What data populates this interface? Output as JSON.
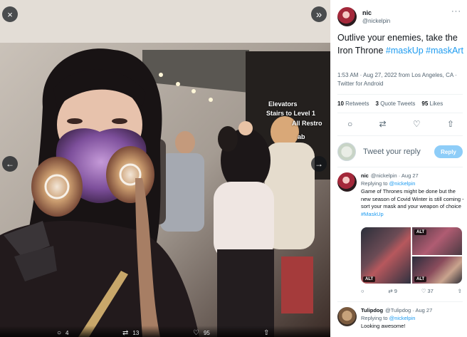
{
  "viewer": {
    "close_label": "×",
    "expand_label": "»",
    "prev_label": "←",
    "next_label": "→",
    "signage": {
      "elevators": "Elevators",
      "stairs": "Stairs to Level 1",
      "restrooms": "All Restro",
      "lab": "ab"
    },
    "bottom_bar": {
      "replies": "4",
      "retweets": "13",
      "likes": "95"
    }
  },
  "tweet": {
    "author": {
      "display_name": "nic",
      "handle": "@nickelpin"
    },
    "text_plain": "Outlive your enemies, take the Iron Throne ",
    "hashtag_1": "#maskUp",
    "hashtag_2": "#maskArt",
    "meta": "1:53 AM · Aug 27, 2022 from Los Angeles, CA · Twitter for Android",
    "stats": {
      "retweets_count": "10",
      "retweets_label": "Retweets",
      "quotes_count": "3",
      "quotes_label": "Quote Tweets",
      "likes_count": "95",
      "likes_label": "Likes"
    }
  },
  "reply_composer": {
    "placeholder": "Tweet your reply",
    "button_label": "Reply"
  },
  "replies": [
    {
      "display_name": "nic",
      "handle": "@nickelpin",
      "date": "· Aug 27",
      "replying_to_prefix": "Replying to",
      "replying_to_handle": "@nickelpin",
      "text": "Game of Thrones might be done but the new season of Covid Winter is still coming - sort your mask and your weapon of choice ",
      "hashtag": "#MaskUp",
      "media_alt_label": "ALT",
      "reply_count": "",
      "retweet_count": "9",
      "like_count": "37"
    },
    {
      "display_name": "Tulipdog",
      "handle": "@Tulipdog",
      "date": "· Aug 27",
      "replying_to_prefix": "Replying to",
      "replying_to_handle": "@nickelpin",
      "text": "Looking awesome!"
    }
  ]
}
